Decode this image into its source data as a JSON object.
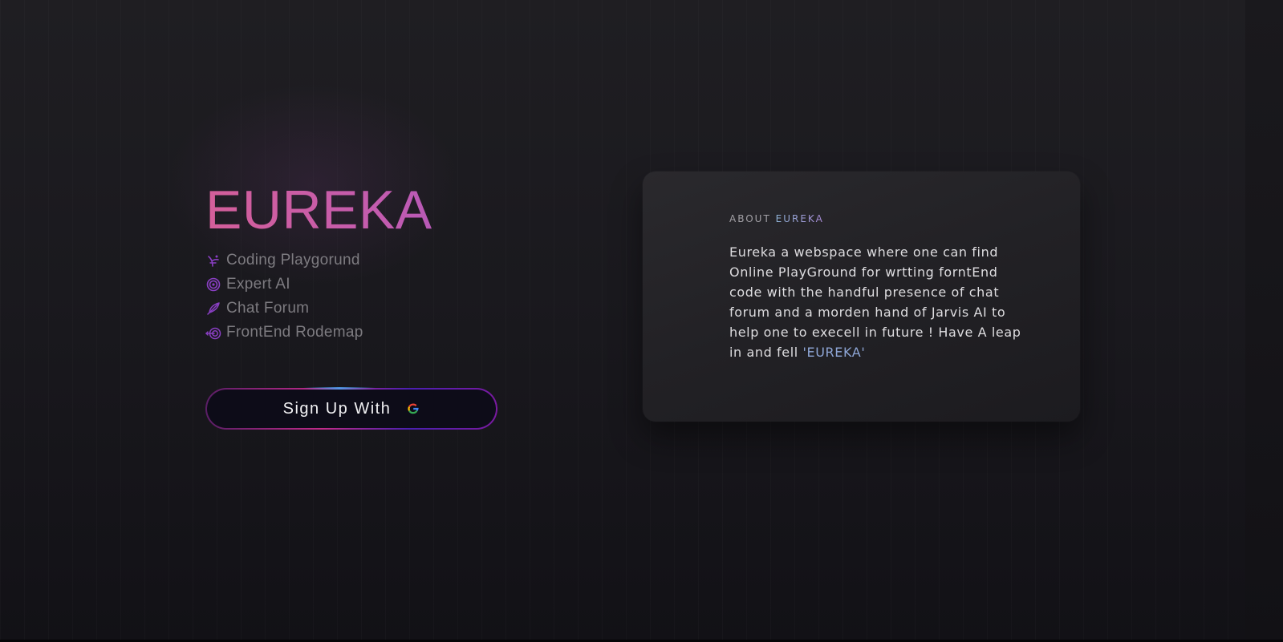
{
  "hero": {
    "brand": "EUREKA",
    "features": [
      {
        "label": "Coding Playgorund",
        "icon": "code-branch-icon"
      },
      {
        "label": "Expert AI",
        "icon": "ai-swirl-icon"
      },
      {
        "label": "Chat Forum",
        "icon": "feather-icon"
      },
      {
        "label": "FrontEnd Rodemap",
        "icon": "target-arrow-icon"
      }
    ],
    "signup": {
      "label": "Sign Up With",
      "provider_icon": "google-icon"
    }
  },
  "about": {
    "prefix": "ABOUT",
    "name": "EUREKA",
    "body": "Eureka a webspace where one can find Online PlayGround for wrtting forntEnd code with the handful presence of chat forum and a morden hand of Jarvis AI to help one to execell in future ! Have A leap in and fell",
    "highlight": "'EUREKA'"
  },
  "colors": {
    "background": "#1a191e",
    "brand_gradient_start": "#d45f9a",
    "brand_gradient_end": "#9a54c8",
    "feature_text": "#7d7b80",
    "card_background": "#242327",
    "accent_blue": "#8ea6d6"
  }
}
